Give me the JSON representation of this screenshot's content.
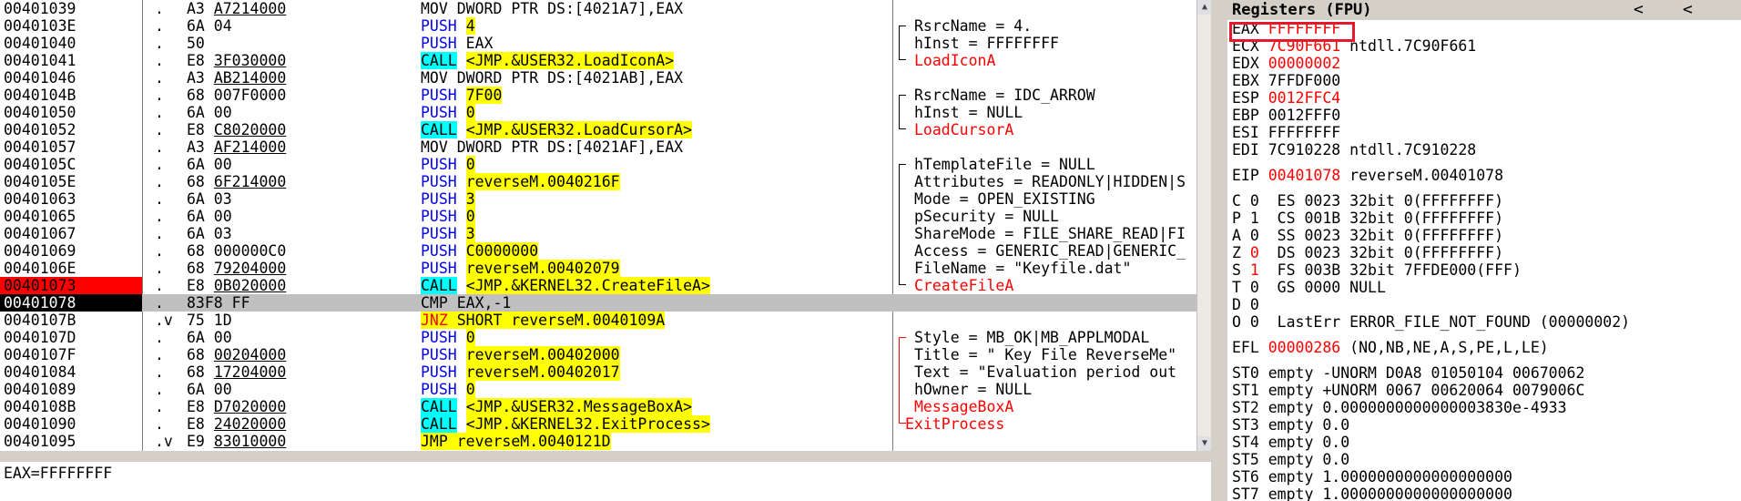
{
  "disasm": {
    "rows": [
      {
        "addr": "00401039",
        "mark": ".",
        "hex": "A3 ",
        "hex_u": "A7214000",
        "asm": [
          [
            "MOV DWORD PTR DS:[4021A7],EAX",
            ""
          ]
        ],
        "cmt": ""
      },
      {
        "addr": "0040103E",
        "mark": ".",
        "hex": "6A 04",
        "hex_u": "",
        "asm": [
          [
            "PUSH",
            "blue"
          ],
          [
            " ",
            ""
          ],
          [
            "4",
            "y"
          ]
        ],
        "cmt": "RsrcName = 4."
      },
      {
        "addr": "00401040",
        "mark": ".",
        "hex": "50",
        "hex_u": "",
        "asm": [
          [
            "PUSH",
            "blue"
          ],
          [
            " EAX",
            ""
          ]
        ],
        "cmt": "hInst = FFFFFFFF"
      },
      {
        "addr": "00401041",
        "mark": ".",
        "hex": "E8 ",
        "hex_u": "3F030000",
        "asm": [
          [
            "CALL",
            "c"
          ],
          [
            " ",
            ""
          ],
          [
            "<JMP.&USER32.LoadIconA>",
            "y"
          ]
        ],
        "cmt": "LoadIconA",
        "cmt_red": true
      },
      {
        "addr": "00401046",
        "mark": ".",
        "hex": "A3 ",
        "hex_u": "AB214000",
        "asm": [
          [
            "MOV DWORD PTR DS:[4021AB],EAX",
            ""
          ]
        ],
        "cmt": ""
      },
      {
        "addr": "0040104B",
        "mark": ".",
        "hex": "68 007F0000",
        "hex_u": "",
        "asm": [
          [
            "PUSH",
            "blue"
          ],
          [
            " ",
            ""
          ],
          [
            "7F00",
            "y"
          ]
        ],
        "cmt": "RsrcName = IDC_ARROW"
      },
      {
        "addr": "00401050",
        "mark": ".",
        "hex": "6A 00",
        "hex_u": "",
        "asm": [
          [
            "PUSH",
            "blue"
          ],
          [
            " ",
            ""
          ],
          [
            "0",
            "y"
          ]
        ],
        "cmt": "hInst = NULL"
      },
      {
        "addr": "00401052",
        "mark": ".",
        "hex": "E8 ",
        "hex_u": "C8020000",
        "asm": [
          [
            "CALL",
            "c"
          ],
          [
            " ",
            ""
          ],
          [
            "<JMP.&USER32.LoadCursorA>",
            "y"
          ]
        ],
        "cmt": "LoadCursorA",
        "cmt_red": true
      },
      {
        "addr": "00401057",
        "mark": ".",
        "hex": "A3 ",
        "hex_u": "AF214000",
        "asm": [
          [
            "MOV DWORD PTR DS:[4021AF],EAX",
            ""
          ]
        ],
        "cmt": ""
      },
      {
        "addr": "0040105C",
        "mark": ".",
        "hex": "6A 00",
        "hex_u": "",
        "asm": [
          [
            "PUSH",
            "blue"
          ],
          [
            " ",
            ""
          ],
          [
            "0",
            "y"
          ]
        ],
        "cmt": "hTemplateFile = NULL"
      },
      {
        "addr": "0040105E",
        "mark": ".",
        "hex": "68 ",
        "hex_u": "6F214000",
        "asm": [
          [
            "PUSH",
            "blue"
          ],
          [
            " ",
            ""
          ],
          [
            "reverseM.0040216F",
            "y"
          ]
        ],
        "cmt": "Attributes = READONLY|HIDDEN|S"
      },
      {
        "addr": "00401063",
        "mark": ".",
        "hex": "6A 03",
        "hex_u": "",
        "asm": [
          [
            "PUSH",
            "blue"
          ],
          [
            " ",
            ""
          ],
          [
            "3",
            "y"
          ]
        ],
        "cmt": "Mode = OPEN_EXISTING"
      },
      {
        "addr": "00401065",
        "mark": ".",
        "hex": "6A 00",
        "hex_u": "",
        "asm": [
          [
            "PUSH",
            "blue"
          ],
          [
            " ",
            ""
          ],
          [
            "0",
            "y"
          ]
        ],
        "cmt": "pSecurity = NULL"
      },
      {
        "addr": "00401067",
        "mark": ".",
        "hex": "6A 03",
        "hex_u": "",
        "asm": [
          [
            "PUSH",
            "blue"
          ],
          [
            " ",
            ""
          ],
          [
            "3",
            "y"
          ]
        ],
        "cmt": "ShareMode = FILE_SHARE_READ|FI"
      },
      {
        "addr": "00401069",
        "mark": ".",
        "hex": "68 000000C0",
        "hex_u": "",
        "asm": [
          [
            "PUSH",
            "blue"
          ],
          [
            " ",
            ""
          ],
          [
            "C0000000",
            "y"
          ]
        ],
        "cmt": "Access = GENERIC_READ|GENERIC_"
      },
      {
        "addr": "0040106E",
        "mark": ".",
        "hex": "68 ",
        "hex_u": "79204000",
        "asm": [
          [
            "PUSH",
            "blue"
          ],
          [
            " ",
            ""
          ],
          [
            "reverseM.00402079",
            "y"
          ]
        ],
        "cmt": "FileName = \"Keyfile.dat\""
      },
      {
        "addr": "00401073",
        "mark": ".",
        "hex": "E8 ",
        "hex_u": "0B020000",
        "asm": [
          [
            "CALL",
            "c"
          ],
          [
            " ",
            ""
          ],
          [
            "<JMP.&KERNEL32.CreateFileA>",
            "y"
          ]
        ],
        "cmt": "CreateFileA",
        "cmt_red": true,
        "addr_style": "red"
      },
      {
        "addr": "00401078",
        "mark": ".",
        "hex": "83F8 FF",
        "hex_u": "",
        "asm": [
          [
            "CMP EAX,-1",
            ""
          ]
        ],
        "cmt": "",
        "addr_style": "black",
        "sel": true
      },
      {
        "addr": "0040107B",
        "mark": ".v",
        "hex": "75 1D",
        "hex_u": "",
        "asm": [
          [
            "JNZ",
            "redy"
          ],
          [
            " SHORT reverseM.0040109A",
            "y"
          ]
        ],
        "cmt": ""
      },
      {
        "addr": "0040107D",
        "mark": ".",
        "hex": "6A 00",
        "hex_u": "",
        "asm": [
          [
            "PUSH",
            "blue"
          ],
          [
            " ",
            ""
          ],
          [
            "0",
            "y"
          ]
        ],
        "cmt": "Style = MB_OK|MB_APPLMODAL"
      },
      {
        "addr": "0040107F",
        "mark": ".",
        "hex": "68 ",
        "hex_u": "00204000",
        "asm": [
          [
            "PUSH",
            "blue"
          ],
          [
            " ",
            ""
          ],
          [
            "reverseM.00402000",
            "y"
          ]
        ],
        "cmt": "Title = \" Key File ReverseMe\""
      },
      {
        "addr": "00401084",
        "mark": ".",
        "hex": "68 ",
        "hex_u": "17204000",
        "asm": [
          [
            "PUSH",
            "blue"
          ],
          [
            " ",
            ""
          ],
          [
            "reverseM.00402017",
            "y"
          ]
        ],
        "cmt": "Text = \"Evaluation period out"
      },
      {
        "addr": "00401089",
        "mark": ".",
        "hex": "6A 00",
        "hex_u": "",
        "asm": [
          [
            "PUSH",
            "blue"
          ],
          [
            " ",
            ""
          ],
          [
            "0",
            "y"
          ]
        ],
        "cmt": "hOwner = NULL"
      },
      {
        "addr": "0040108B",
        "mark": ".",
        "hex": "E8 ",
        "hex_u": "D7020000",
        "asm": [
          [
            "CALL",
            "c"
          ],
          [
            " ",
            ""
          ],
          [
            "<JMP.&USER32.MessageBoxA>",
            "y"
          ]
        ],
        "cmt": "MessageBoxA",
        "cmt_red": true
      },
      {
        "addr": "00401090",
        "mark": ".",
        "hex": "E8 ",
        "hex_u": "24020000",
        "asm": [
          [
            "CALL",
            "c"
          ],
          [
            " ",
            ""
          ],
          [
            "<JMP.&KERNEL32.ExitProcess>",
            "y"
          ]
        ],
        "cmt": "ExitProcess",
        "cmt_red": true,
        "cmt_left": true
      },
      {
        "addr": "00401095",
        "mark": ".v",
        "hex": "E9 ",
        "hex_u": "83010000",
        "asm": [
          [
            "JMP reverseM.0040121D",
            "y"
          ]
        ],
        "cmt": ""
      }
    ]
  },
  "registers": {
    "title": "Registers (FPU)",
    "nav": [
      "<",
      "<"
    ],
    "rows": [
      [
        [
          "EAX ",
          ""
        ],
        [
          "FFFFFFFF",
          "red"
        ]
      ],
      [
        [
          "ECX ",
          ""
        ],
        [
          "7C90F661",
          "red"
        ],
        [
          " ntdll.7C90F661",
          ""
        ]
      ],
      [
        [
          "EDX ",
          ""
        ],
        [
          "00000002",
          "red"
        ]
      ],
      [
        [
          "EBX 7FFDF000",
          ""
        ]
      ],
      [
        [
          "ESP ",
          ""
        ],
        [
          "0012FFC4",
          "red"
        ]
      ],
      [
        [
          "EBP 0012FFF0",
          ""
        ]
      ],
      [
        [
          "ESI FFFFFFFF",
          ""
        ]
      ],
      [
        [
          "EDI 7C910228 ntdll.7C910228",
          ""
        ]
      ],
      null,
      [
        [
          "EIP ",
          ""
        ],
        [
          "00401078",
          "red"
        ],
        [
          " reverseM.00401078",
          ""
        ]
      ],
      null,
      [
        [
          "C 0  ES 0023 32bit 0(FFFFFFFF)",
          ""
        ]
      ],
      [
        [
          "P 1  CS 001B 32bit 0(FFFFFFFF)",
          ""
        ]
      ],
      [
        [
          "A 0  SS 0023 32bit 0(FFFFFFFF)",
          ""
        ]
      ],
      [
        [
          "Z ",
          ""
        ],
        [
          "0",
          "red"
        ],
        [
          "  DS 0023 32bit 0(FFFFFFFF)",
          ""
        ]
      ],
      [
        [
          "S ",
          ""
        ],
        [
          "1",
          "red"
        ],
        [
          "  FS 003B 32bit 7FFDE000(FFF)",
          ""
        ]
      ],
      [
        [
          "T 0  GS 0000 NULL",
          ""
        ]
      ],
      [
        [
          "D 0",
          ""
        ]
      ],
      [
        [
          "O 0  LastErr ERROR_FILE_NOT_FOUND (00000002)",
          ""
        ]
      ],
      null,
      [
        [
          "EFL ",
          ""
        ],
        [
          "00000286",
          "red"
        ],
        [
          " (NO,NB,NE,A,S,PE,L,LE)",
          ""
        ]
      ],
      null,
      [
        [
          "ST0 empty -UNORM D0A8 01050104 00670062",
          ""
        ]
      ],
      [
        [
          "ST1 empty +UNORM 0067 00620064 0079006C",
          ""
        ]
      ],
      [
        [
          "ST2 empty 0.0000000000000003830e-4933",
          ""
        ]
      ],
      [
        [
          "ST3 empty 0.0",
          ""
        ]
      ],
      [
        [
          "ST4 empty 0.0",
          ""
        ]
      ],
      [
        [
          "ST5 empty 0.0",
          ""
        ]
      ],
      [
        [
          "ST6 empty 1.0000000000000000000",
          ""
        ]
      ],
      [
        [
          "ST7 empty 1.0000000000000000000",
          ""
        ]
      ]
    ]
  },
  "info_bar": {
    "text": "EAX=FFFFFFFF"
  },
  "colors": {
    "accent_yellow": "#ffff00",
    "accent_cyan": "#00ffff",
    "changed_red": "#ff0000",
    "selection_gray": "#c0c0c0"
  }
}
